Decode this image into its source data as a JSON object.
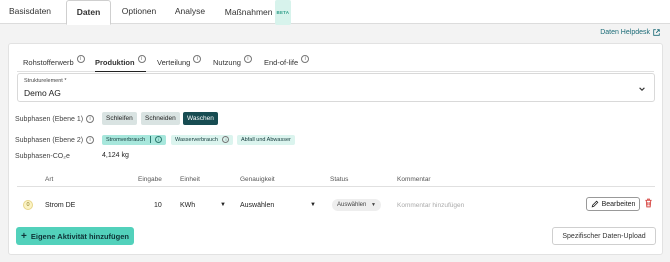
{
  "top_tabs": [
    {
      "label": "Basisdaten"
    },
    {
      "label": "Daten",
      "active": true
    },
    {
      "label": "Optionen"
    },
    {
      "label": "Analyse"
    },
    {
      "label": "Maßnahmen",
      "badge": "BETA"
    }
  ],
  "helpdesk": {
    "label": "Daten Helpdesk",
    "icon": "external-link-icon"
  },
  "sub_tabs": [
    {
      "label": "Rohstofferwerb"
    },
    {
      "label": "Produktion",
      "active": true
    },
    {
      "label": "Verteilung"
    },
    {
      "label": "Nutzung"
    },
    {
      "label": "End-of-life"
    }
  ],
  "strukturelement": {
    "label": "Strukturelement *",
    "value": "Demo AG"
  },
  "subphasen1": {
    "label": "Subphasen (Ebene 1)",
    "chips": [
      "Schleifen",
      "Schneiden",
      "Waschen"
    ]
  },
  "subphasen2": {
    "label": "Subphasen (Ebene 2)",
    "chips": [
      "Stromverbrauch",
      "Wasserverbrauch",
      "Abfall und Abwasser"
    ]
  },
  "co2": {
    "label": "Subphasen-CO₂e",
    "value": "4,124 kg"
  },
  "table": {
    "headers": [
      "Art",
      "Eingabe",
      "Einheit",
      "Genauigkeit",
      "Status",
      "Kommentar"
    ],
    "row": {
      "badge": "0",
      "art": "Strom DE",
      "eingabe": "10",
      "einheit": "KWh",
      "genauigkeit": "Auswählen",
      "status": "Auswählen",
      "kommentar_placeholder": "Kommentar hinzufügen",
      "edit_label": "Bearbeiten"
    }
  },
  "add_button": {
    "label": "Eigene Aktivität hinzufügen"
  },
  "upload_button": {
    "label": "Spezifischer Daten-Upload"
  },
  "colors": {
    "accent": "#52d1bb",
    "dark_chip": "#174c52",
    "delete": "#d64541"
  }
}
